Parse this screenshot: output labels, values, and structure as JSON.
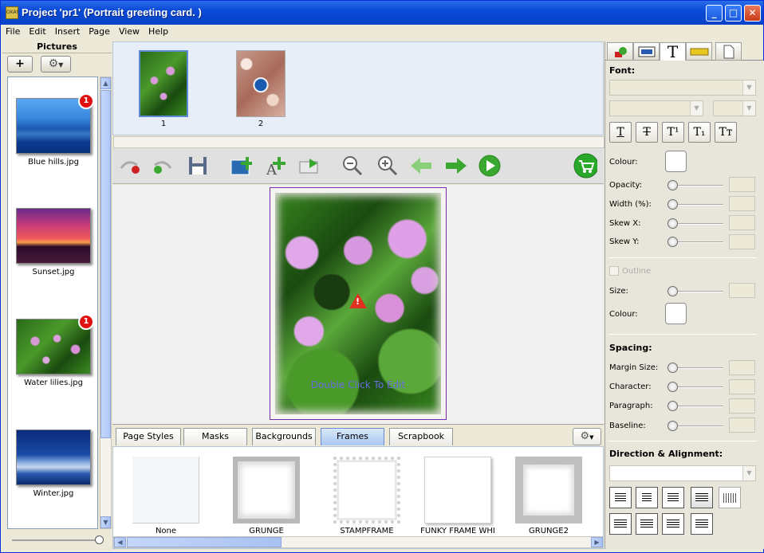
{
  "window": {
    "title": "Project 'pr1' (Portrait greeting card. )",
    "minimize": "_",
    "maximize": "□",
    "close": "✕"
  },
  "menu": [
    "File",
    "Edit",
    "Insert",
    "Page",
    "View",
    "Help"
  ],
  "pictures": {
    "header": "Pictures",
    "add_label": "+",
    "items": [
      {
        "name": "Blue hills.jpg",
        "badge": "1"
      },
      {
        "name": "Sunset.jpg",
        "badge": ""
      },
      {
        "name": "Water lilies.jpg",
        "badge": "1"
      },
      {
        "name": "Winter.jpg",
        "badge": ""
      }
    ]
  },
  "pages": [
    {
      "number": "1",
      "selected": true
    },
    {
      "number": "2",
      "selected": false
    }
  ],
  "canvas": {
    "hint": "Double Click To Edit",
    "warning": "!"
  },
  "tabs": [
    {
      "label": "Page Styles",
      "active": false
    },
    {
      "label": "Masks",
      "active": false
    },
    {
      "label": "Backgrounds",
      "active": false
    },
    {
      "label": "Frames",
      "active": true
    },
    {
      "label": "Scrapbook",
      "active": false
    }
  ],
  "frames": [
    {
      "name": "None"
    },
    {
      "name": "GRUNGE"
    },
    {
      "name": "STAMPFRAME"
    },
    {
      "name": "FUNKY FRAME WHI"
    },
    {
      "name": "GRUNGE2"
    }
  ],
  "text_panel": {
    "font_label": "Font:",
    "style_buttons": [
      "T",
      "T",
      "T¹",
      "T₁",
      "Tт"
    ],
    "colour_label": "Colour:",
    "sliders": [
      "Opacity:",
      "Width (%):",
      "Skew X:",
      "Skew Y:"
    ],
    "outline_label": "Outline",
    "size_label": "Size:",
    "outline_colour_label": "Colour:",
    "spacing_label": "Spacing:",
    "spacing_sliders": [
      "Margin Size:",
      "Character:",
      "Paragraph:",
      "Baseline:"
    ],
    "direction_label": "Direction & Alignment:"
  },
  "colors": {
    "titlebar": "#0a4ad8",
    "badge": "#e01010",
    "accent_green": "#3aa830",
    "frame_border": "#7a2aa8"
  }
}
